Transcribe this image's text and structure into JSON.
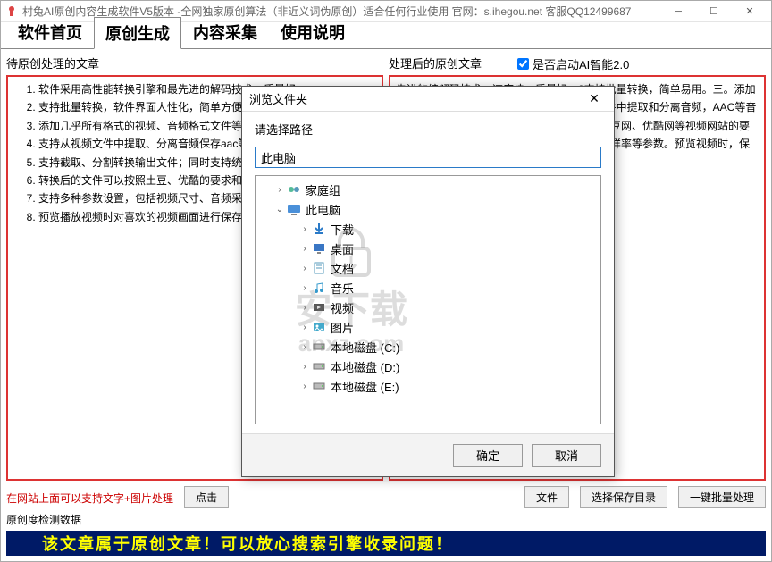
{
  "titlebar": {
    "text": "村兔AI原创内容生成软件V5版本 -全网独家原创算法（非近义词伪原创）适合任何行业使用 官网：s.ihegou.net 客服QQ12499687"
  },
  "tabs": [
    {
      "label": "软件首页",
      "active": false
    },
    {
      "label": "原创生成",
      "active": true
    },
    {
      "label": "内容采集",
      "active": false
    },
    {
      "label": "使用说明",
      "active": false
    }
  ],
  "left": {
    "label": "待原创处理的文章",
    "items": [
      "软件采用高性能转换引擎和最先进的解码技术，质量好",
      "支持批量转换，软件界面人性化，简单方便",
      "添加几乎所有格式的视频、音频格式文件等格式",
      "支持从视频文件中提取、分离音频保存aac等音频格式",
      "支持截取、分割转换输出文件；同时支持统一格式",
      "转换后的文件可以按照土豆、优酷的要求和朋友共享",
      "支持多种参数设置，包括视频尺寸、音频采样率等参数",
      "预览播放视频时对喜欢的视频画面进行保存"
    ]
  },
  "right": {
    "label": "处理后的原创文章",
    "checkbox": "是否启动AI智能2.0",
    "text": "先进的编解码技术，速度快，质量好。2支持批量转换，简单易用。三。添加几乎所有的视频和音频格式。4支持从视频文件中提取和分离音频，AAC等音频格式；同时支持不同格式的文件可以根据土豆网、优酷网等视频网站的要求支持多种参数设置，包括视频大小、视频采样率等参数。预览视频时，保存您喜爱的视频"
  },
  "note": "在网站上面可以支持文字+图片处理",
  "buttons": {
    "click": "点击",
    "file": "文件",
    "selectSave": "选择保存目录",
    "batch": "一键批量处理"
  },
  "status": {
    "label": "原创度检测数据",
    "text": "该文章属于原创文章！可以放心搜索引擎收录问题！"
  },
  "dialog": {
    "title": "浏览文件夹",
    "prompt": "请选择路径",
    "input": "此电脑",
    "ok": "确定",
    "cancel": "取消",
    "tree": [
      {
        "level": 1,
        "expander": ">",
        "icon": "homegroup",
        "label": "家庭组"
      },
      {
        "level": 1,
        "expander": "v",
        "icon": "pc",
        "label": "此电脑"
      },
      {
        "level": 2,
        "expander": ">",
        "icon": "download",
        "label": "下载"
      },
      {
        "level": 2,
        "expander": ">",
        "icon": "desktop",
        "label": "桌面"
      },
      {
        "level": 2,
        "expander": ">",
        "icon": "docs",
        "label": "文档"
      },
      {
        "level": 2,
        "expander": ">",
        "icon": "music",
        "label": "音乐"
      },
      {
        "level": 2,
        "expander": ">",
        "icon": "video",
        "label": "视频"
      },
      {
        "level": 2,
        "expander": ">",
        "icon": "pics",
        "label": "图片"
      },
      {
        "level": 2,
        "expander": ">",
        "icon": "drive",
        "label": "本地磁盘 (C:)"
      },
      {
        "level": 2,
        "expander": ">",
        "icon": "drive",
        "label": "本地磁盘 (D:)"
      },
      {
        "level": 2,
        "expander": ">",
        "icon": "drive",
        "label": "本地磁盘 (E:)"
      }
    ]
  },
  "watermark": {
    "icon": "安下载",
    "url": "anxz.com"
  }
}
